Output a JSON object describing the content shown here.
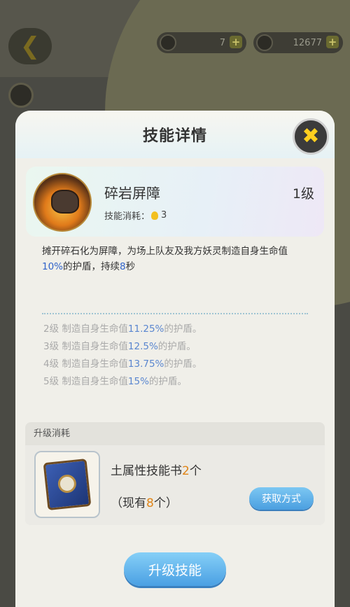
{
  "topbar": {
    "currency1": {
      "icon": "coin-icon",
      "value": "7"
    },
    "currency2": {
      "icon": "crystal-icon",
      "value": "12677"
    }
  },
  "modal": {
    "title": "技能详情",
    "skill": {
      "name": "碎岩屏障",
      "level": "1级",
      "cost_label": "技能消耗：",
      "cost_value": "3"
    },
    "description": {
      "part1": "摊开碎石化为屏障，为场上队友及我方妖灵制造自身生命值",
      "percent": "10%",
      "part2": "的护盾，持续",
      "duration": "8",
      "part3": "秒"
    },
    "levels": [
      {
        "level": "2级",
        "prefix": "制造自身生命值",
        "value": "11.25%",
        "suffix": "的护盾。"
      },
      {
        "level": "3级",
        "prefix": "制造自身生命值",
        "value": "12.5%",
        "suffix": "的护盾。"
      },
      {
        "level": "4级",
        "prefix": "制造自身生命值",
        "value": "13.75%",
        "suffix": "的护盾。"
      },
      {
        "level": "5级",
        "prefix": "制造自身生命值",
        "value": "15%",
        "suffix": "的护盾。"
      }
    ],
    "upgrade_cost": {
      "header": "升级消耗",
      "item_name": "土属性技能书",
      "item_count": "2",
      "item_unit": "个",
      "owned_prefix": "（现有",
      "owned_count": "8",
      "owned_suffix": "个）",
      "get_button": "获取方式"
    },
    "upgrade_button": "升级技能"
  },
  "colors": {
    "accent_blue": "#4aa0e3",
    "highlight_blue": "#2f62c9",
    "orange": "#e08416",
    "close_x": "#ffcf1f"
  }
}
